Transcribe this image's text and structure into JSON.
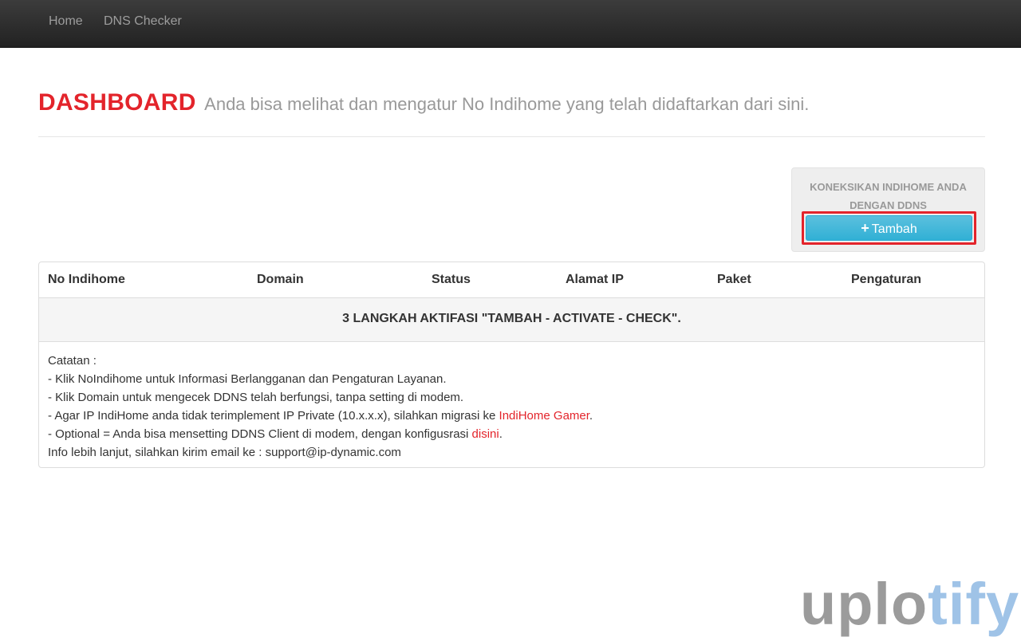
{
  "nav": {
    "home": "Home",
    "dns_checker": "DNS Checker"
  },
  "header": {
    "title": "DASHBOARD",
    "subtitle": "Anda bisa melihat dan mengatur No Indihome yang telah didaftarkan dari sini."
  },
  "connect_box": {
    "text": "KONEKSIKAN INDIHOME ANDA DENGAN DDNS",
    "button_icon": "plus-icon",
    "button_label": "Tambah"
  },
  "table": {
    "columns": [
      "No Indihome",
      "Domain",
      "Status",
      "Alamat IP",
      "Paket",
      "Pengaturan"
    ],
    "notice": "3 LANGKAH AKTIFASI \"TAMBAH - ACTIVATE - CHECK\"."
  },
  "notes": {
    "heading": "Catatan :",
    "line1": "- Klik NoIndihome untuk Informasi Berlangganan dan Pengaturan Layanan.",
    "line2": "- Klik Domain untuk mengecek DDNS telah berfungsi, tanpa setting di modem.",
    "line3_prefix": "- Agar IP IndiHome anda tidak terimplement IP Private (10.x.x.x), silahkan migrasi ke ",
    "line3_link": "IndiHome Gamer",
    "line3_suffix": ".",
    "line4_prefix": "- Optional = Anda bisa mensetting DDNS Client di modem, dengan konfigusrasi ",
    "line4_link": "disini",
    "line4_suffix": ".",
    "line5": "Info lebih lanjut, silahkan kirim email ke : support@ip-dynamic.com"
  },
  "watermark": {
    "part1": "uplo",
    "part2": "tify"
  },
  "colors": {
    "accent_red": "#e3242b",
    "button_blue": "#31b0d5",
    "navbar_dark": "#2b2b2b"
  }
}
